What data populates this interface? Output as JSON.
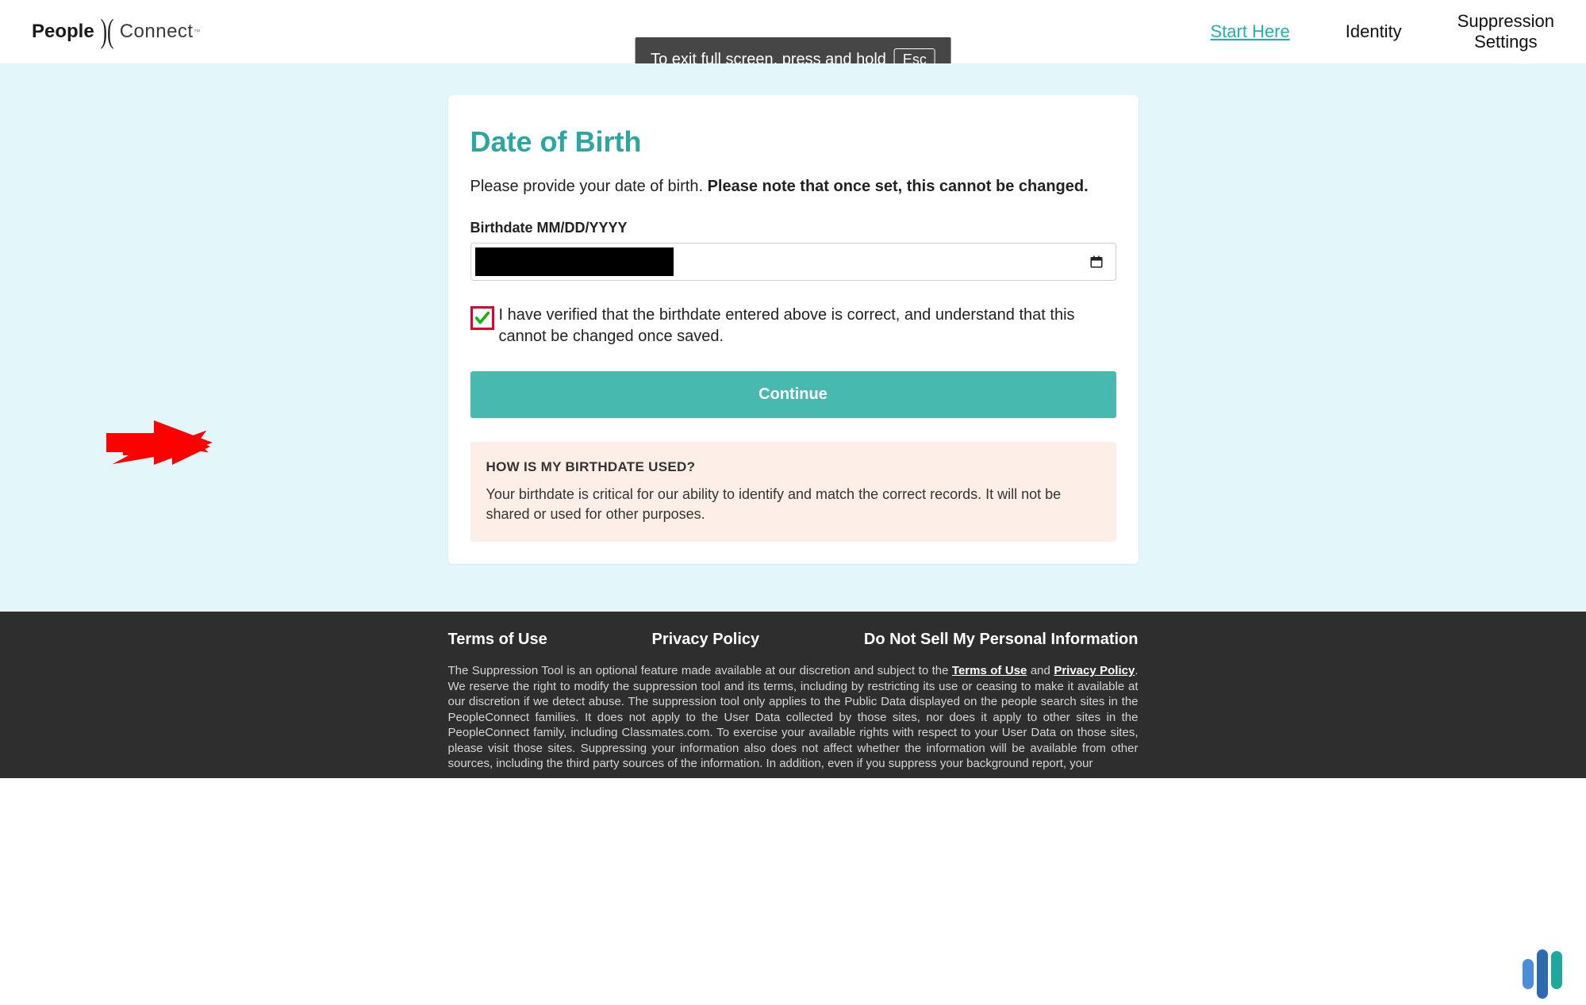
{
  "header": {
    "logo": {
      "p1": "People",
      "p2": "Connect",
      "tm": "™"
    },
    "nav": {
      "start": "Start Here",
      "identity": "Identity",
      "suppression_l1": "Suppression",
      "suppression_l2": "Settings"
    }
  },
  "overlay": {
    "text": "To exit full screen, press and hold",
    "key": "Esc"
  },
  "card": {
    "title": "Date of Birth",
    "desc_plain": "Please provide your date of birth. ",
    "desc_bold": "Please note that once set, this cannot be changed.",
    "input_label": "Birthdate MM/DD/YYYY",
    "checkbox_text": "I have verified that the birthdate entered above is correct, and understand that this cannot be changed once saved.",
    "continue": "Continue",
    "info_title": "HOW IS MY BIRTHDATE USED?",
    "info_text": "Your birthdate is critical for our ability to identify and match the correct records. It will not be shared or used for other purposes."
  },
  "footer": {
    "links": {
      "terms": "Terms of Use",
      "privacy": "Privacy Policy",
      "dns": "Do Not Sell My Personal Information"
    },
    "disclaimer_p1": "The Suppression Tool is an optional feature made available at our discretion and subject to the ",
    "disclaimer_terms": "Terms of Use",
    "disclaimer_and": " and ",
    "disclaimer_privacy": "Privacy Policy",
    "disclaimer_p2": ". We reserve the right to modify the suppression tool and its terms, including by restricting its use or ceasing to make it available at our discretion if we detect abuse. The suppression tool only applies to the Public Data displayed on the people search sites in the PeopleConnect families. It does not apply to the User Data collected by those sites, nor does it apply to other sites in the PeopleConnect family, including Classmates.com. To exercise your available rights with respect to your User Data on those sites, please visit those sites. Suppressing your information also does not affect whether the information will be available from other sources, including the third party sources of the information. In addition, even if you suppress your background report, your"
  },
  "colors": {
    "accent": "#2AA79E",
    "button": "#48B9AE",
    "bg": "#E3F6FA",
    "highlight": "#E4002B"
  }
}
